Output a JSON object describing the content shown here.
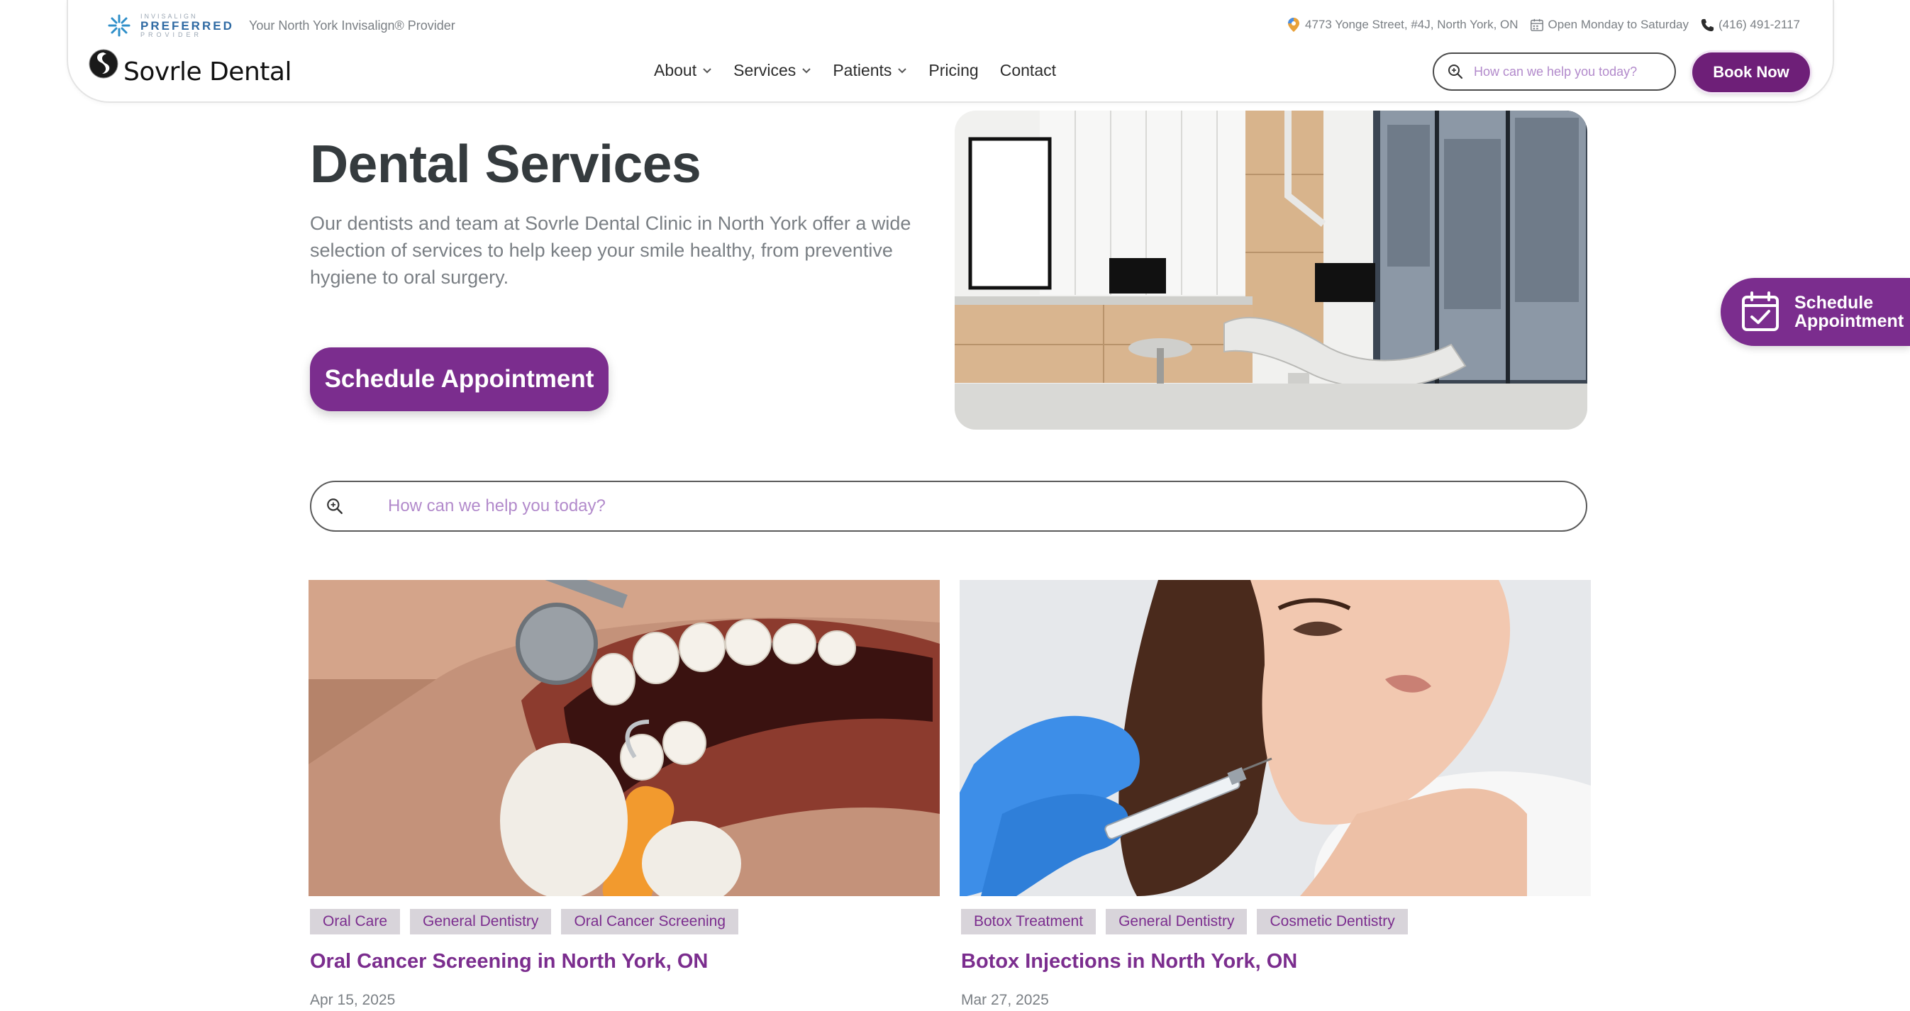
{
  "topbar": {
    "invisalign_small": "INVISALIGN",
    "invisalign_big": "PREFERRED",
    "invisalign_provider": "PROVIDER",
    "provider_text": "Your North York Invisalign® Provider",
    "address": "4773 Yonge Street, #4J, North York, ON",
    "hours": "Open Monday to Saturday",
    "phone": "(416) 491-2117"
  },
  "logo": {
    "text": "Sovrle Dental"
  },
  "nav": [
    {
      "label": "About",
      "has_dropdown": true
    },
    {
      "label": "Services",
      "has_dropdown": true
    },
    {
      "label": "Patients",
      "has_dropdown": true
    },
    {
      "label": "Pricing",
      "has_dropdown": false
    },
    {
      "label": "Contact",
      "has_dropdown": false
    }
  ],
  "header_search": {
    "placeholder": "How can we help you today?"
  },
  "book_button": {
    "label": "Book Now"
  },
  "hero": {
    "title": "Dental Services",
    "description": "Our dentists and team at Sovrle Dental Clinic in North York offer a wide selection of services to help keep your smile healthy, from preventive hygiene to oral surgery.",
    "button_label": "Schedule Appointment"
  },
  "side_tab": {
    "label_line1": "Schedule",
    "label_line2": "Appointment"
  },
  "main_search": {
    "placeholder": "How can we help you today?"
  },
  "cards": [
    {
      "tags": [
        "Oral Care",
        "General Dentistry",
        "Oral Cancer Screening"
      ],
      "title": "Oral Cancer Screening in North York, ON",
      "date": "Apr 15, 2025"
    },
    {
      "tags": [
        "Botox Treatment",
        "General Dentistry",
        "Cosmetic Dentistry"
      ],
      "title": "Botox Injections in North York, ON",
      "date": "Mar 27, 2025"
    }
  ],
  "colors": {
    "brand_purple": "#7b2d8e",
    "book_button": "#6e1f78",
    "text_dark": "#353b3e",
    "text_muted": "#7a7f84",
    "tag_bg": "#d8d4da",
    "placeholder": "#b28acb"
  },
  "icons": [
    "invisalign-star-icon",
    "map-pin-icon",
    "calendar-icon",
    "phone-icon",
    "chevron-down-icon",
    "search-icon",
    "calendar-check-icon"
  ]
}
